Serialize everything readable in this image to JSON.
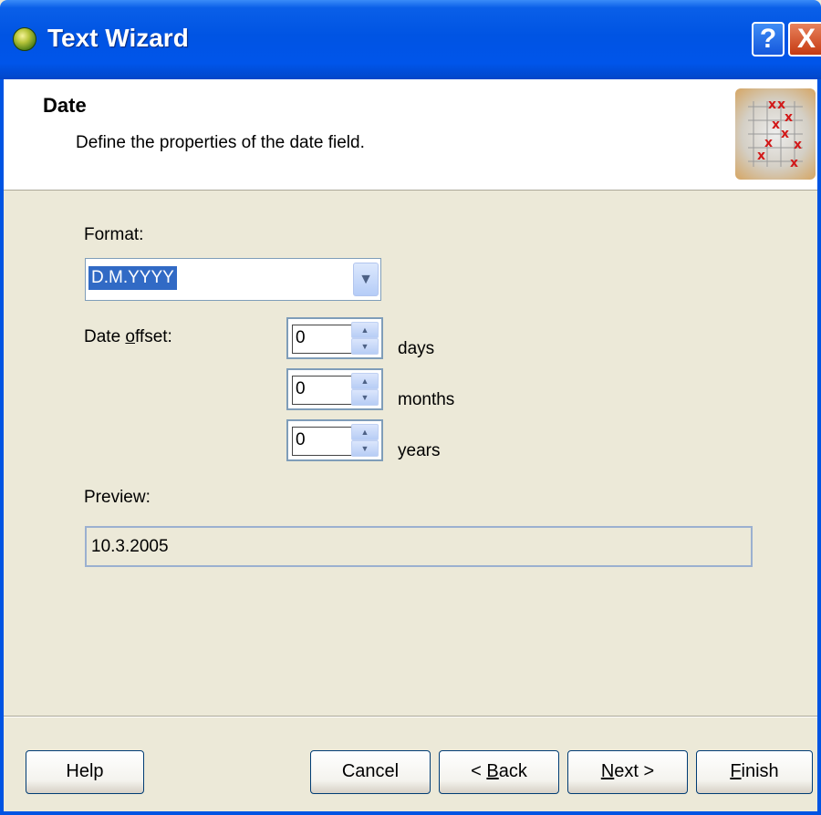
{
  "window": {
    "title": "Text Wizard",
    "help_glyph": "?",
    "close_glyph": "X"
  },
  "header": {
    "title": "Date",
    "subtitle": "Define the properties of the date field."
  },
  "form": {
    "format_label": "Format:",
    "format_value": "D.M.YYYY",
    "date_offset_label_pre": "Date ",
    "date_offset_label_accel": "o",
    "date_offset_label_post": "ffset:",
    "offsets": [
      {
        "value": "0",
        "unit": "days"
      },
      {
        "value": "0",
        "unit": "months"
      },
      {
        "value": "0",
        "unit": "years"
      }
    ],
    "preview_label": "Preview:",
    "preview_value": "10.3.2005"
  },
  "buttons": {
    "help": "Help",
    "cancel": "Cancel",
    "back_prefix": "< ",
    "back_accel": "B",
    "back_rest": "ack",
    "next_accel": "N",
    "next_rest": "ext >",
    "finish_accel": "F",
    "finish_rest": "inish"
  },
  "icons": {
    "app": "wizard-globe-icon",
    "header_graphic": "grid-plot-icon",
    "dropdown": "chevron-down-icon",
    "spin_up": "arrow-up-icon",
    "spin_down": "arrow-down-icon"
  },
  "colors": {
    "titlebar": "#0054e3",
    "selection": "#316ac5",
    "dialog_bg": "#ece9d8"
  }
}
